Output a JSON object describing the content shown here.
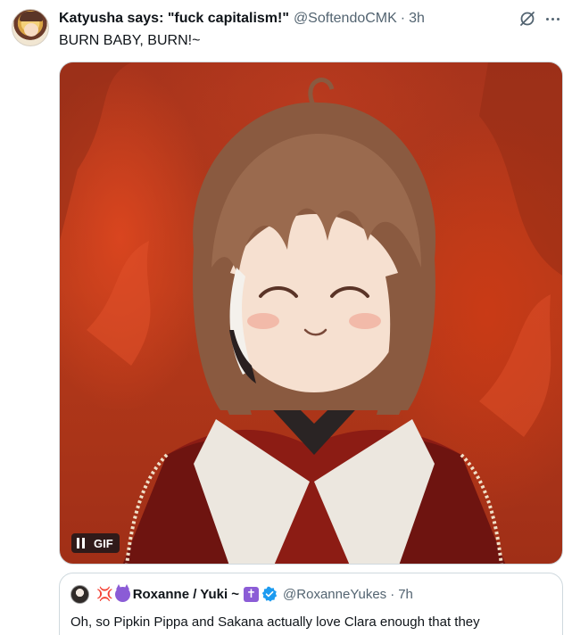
{
  "tweet": {
    "display_name": "Katyusha says: \"fuck capitalism!\"",
    "handle": "@SoftendoCMK",
    "separator": "·",
    "time": "3h",
    "text": "BURN BABY, BURN!~",
    "icons": {
      "grok": "grok-icon",
      "more": "more-icon",
      "avatar": "avatar"
    }
  },
  "media": {
    "badge_label": "GIF",
    "badge_icon": "pause-icon",
    "description_colors": {
      "background": "#b63a1a",
      "hair": "#8a5a40",
      "dress": "#8c1c14"
    }
  },
  "quote": {
    "emoji_anger": "💢",
    "name": "Roxanne / Yuki ~",
    "cross": "✝",
    "handle": "@RoxanneYukes",
    "separator": "·",
    "time": "7h",
    "text": "Oh, so Pipkin Pippa and Sakana actually love Clara enough that they",
    "icons": {
      "devil": "smiling-devil-emoji",
      "verified": "verified-badge-icon"
    }
  },
  "colors": {
    "text_primary": "#0f1419",
    "text_secondary": "#536471",
    "border": "#cfd9de",
    "verified": "#1d9bf0"
  }
}
